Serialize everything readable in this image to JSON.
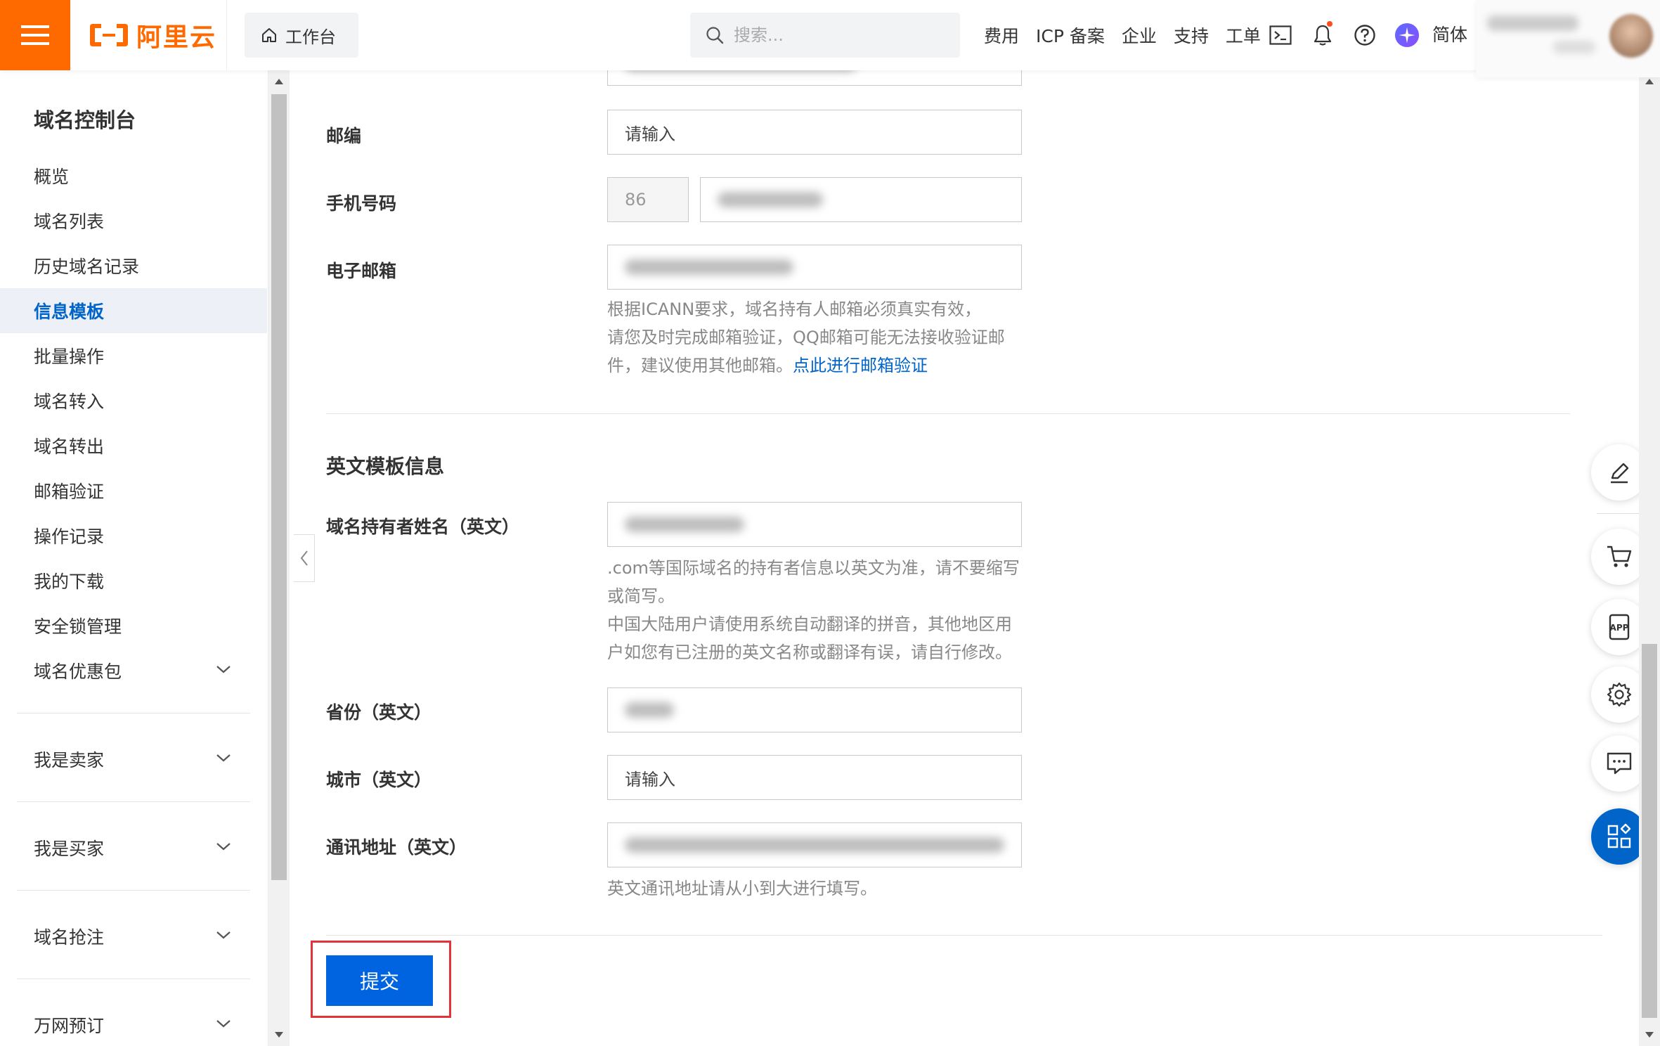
{
  "header": {
    "logo_text": "阿里云",
    "workbench_label": "工作台",
    "search_placeholder": "搜索...",
    "links": [
      "费用",
      "ICP 备案",
      "企业",
      "支持",
      "工单"
    ],
    "language": "简体",
    "brand_color": "#ff6a00"
  },
  "sidebar": {
    "title": "域名控制台",
    "items": [
      {
        "label": "概览"
      },
      {
        "label": "域名列表"
      },
      {
        "label": "历史域名记录"
      },
      {
        "label": "信息模板",
        "active": true
      },
      {
        "label": "批量操作"
      },
      {
        "label": "域名转入"
      },
      {
        "label": "域名转出"
      },
      {
        "label": "邮箱验证"
      },
      {
        "label": "操作记录"
      },
      {
        "label": "我的下载"
      },
      {
        "label": "安全锁管理"
      },
      {
        "label": "域名优惠包",
        "expandable": true
      }
    ],
    "groups": [
      {
        "label": "我是卖家"
      },
      {
        "label": "我是买家"
      },
      {
        "label": "域名抢注"
      },
      {
        "label": "万网预订"
      }
    ]
  },
  "form": {
    "postcode": {
      "label": "邮编",
      "placeholder": "请输入"
    },
    "phone": {
      "label": "手机号码",
      "country_code": "86"
    },
    "email": {
      "label": "电子邮箱",
      "hint_line1": "根据ICANN要求，域名持有人邮箱必须真实有效，",
      "hint_line2": "请您及时完成邮箱验证，QQ邮箱可能无法接收验证邮",
      "hint_line3": "件，建议使用其他邮箱。",
      "verify_link": "点此进行邮箱验证"
    },
    "english_section_title": "英文模板信息",
    "owner_name_en": {
      "label": "域名持有者姓名（英文）",
      "hint_line1": ".com等国际域名的持有者信息以英文为准，请不要缩写",
      "hint_line2": "或简写。",
      "hint_line3": "中国大陆用户请使用系统自动翻译的拼音，其他地区用",
      "hint_line4": "户如您有已注册的英文名称或翻译有误，请自行修改。"
    },
    "province_en": {
      "label": "省份（英文）"
    },
    "city_en": {
      "label": "城市（英文）",
      "placeholder": "请输入"
    },
    "address_en": {
      "label": "通讯地址（英文）",
      "hint": "英文通讯地址请从小到大进行填写。"
    },
    "submit_label": "提交",
    "accent_color": "#0064c8",
    "highlight_color": "#e0333a"
  },
  "float_tools": [
    "edit-icon",
    "cart-icon",
    "app-icon",
    "settings-icon",
    "chat-icon",
    "apps-grid-icon"
  ]
}
